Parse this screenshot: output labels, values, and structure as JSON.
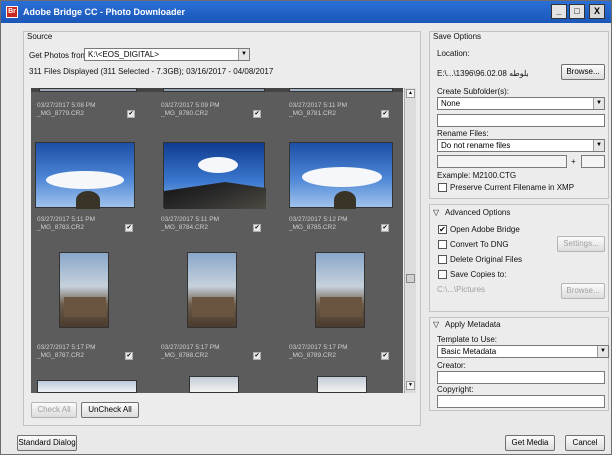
{
  "window": {
    "title": "Adobe Bridge CC - Photo Downloader",
    "app_icon": "Br",
    "controls": {
      "minimize": "_",
      "maximize": "□",
      "close": "X"
    }
  },
  "source": {
    "header": "Source",
    "get_photos_label": "Get Photos from:",
    "source_value": "K:\\<EOS_DIGITAL>",
    "files_info": "311 Files Displayed (311 Selected - 7.3GB); 03/16/2017 - 04/08/2017"
  },
  "thumbnails": [
    {
      "date": "03/27/2017 5:08 PM",
      "name": "_MG_8779.CR2",
      "kind": "partial"
    },
    {
      "date": "03/27/2017 5:09 PM",
      "name": "_MG_8780.CR2",
      "kind": "partial"
    },
    {
      "date": "03/27/2017 5:11 PM",
      "name": "_MG_8781.CR2",
      "kind": "partial"
    },
    {
      "date": "03/27/2017 5:11 PM",
      "name": "_MG_8783.CR2",
      "kind": "sky"
    },
    {
      "date": "03/27/2017 5:11 PM",
      "name": "_MG_8784.CR2",
      "kind": "sky"
    },
    {
      "date": "03/27/2017 5:12 PM",
      "name": "_MG_8785.CR2",
      "kind": "sky"
    },
    {
      "date": "03/27/2017 5:17 PM",
      "name": "_MG_8787.CR2",
      "kind": "vertical"
    },
    {
      "date": "03/27/2017 5:17 PM",
      "name": "_MG_8788.CR2",
      "kind": "vertical"
    },
    {
      "date": "03/27/2017 5:17 PM",
      "name": "_MG_8789.CR2",
      "kind": "vertical"
    }
  ],
  "grid_footer": {
    "check_all": "Check All",
    "uncheck_all": "UnCheck All"
  },
  "save_options": {
    "header": "Save Options",
    "location_label": "Location:",
    "location_value": "E:\\...\\1396\\96.02.08 بلوطه",
    "browse_label": "Browse...",
    "create_subfolders_label": "Create Subfolder(s):",
    "create_subfolders_value": "None",
    "rename_files_label": "Rename Files:",
    "rename_files_value": "Do not rename files",
    "plus": "+",
    "example": "Example: M2100.CTG",
    "preserve_filename_label": "Preserve Current Filename in XMP"
  },
  "advanced_options": {
    "header": "Advanced Options",
    "open_bridge": "Open Adobe Bridge",
    "convert_dng": "Convert To DNG",
    "settings": "Settings...",
    "delete_original": "Delete Original Files",
    "save_copies": "Save Copies to:",
    "copies_path": "C:\\...\\Pictures",
    "browse2": "Browse..."
  },
  "apply_metadata": {
    "header": "Apply Metadata",
    "template_label": "Template to Use:",
    "template_value": "Basic Metadata",
    "creator_label": "Creator:",
    "copyright_label": "Copyright:"
  },
  "footer": {
    "standard_dialog": "Standard Dialog",
    "get_media": "Get Media",
    "cancel": "Cancel"
  },
  "icons": {
    "check_mark": "✔",
    "dropdown": "▼",
    "collapse": "▽",
    "scroll_up": "▲",
    "scroll_down": "▼"
  }
}
